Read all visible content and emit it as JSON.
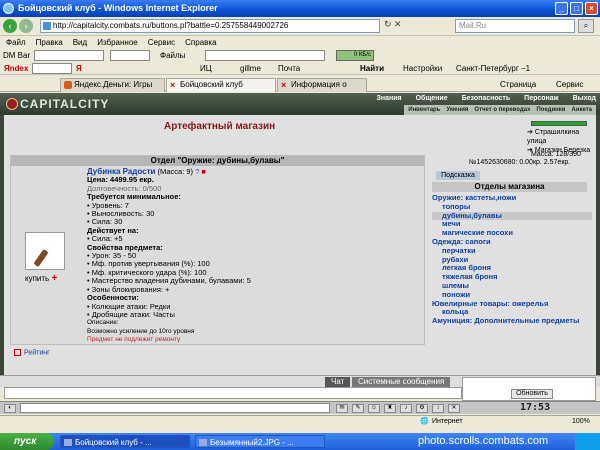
{
  "window": {
    "title": "Бойцовский клуб - Windows Internet Explorer"
  },
  "address": {
    "url": "http://capitalcity.combats.ru/buttons.pl?battle=0.257558449002726",
    "search_placeholder": "Mail.Ru"
  },
  "menu": [
    "Файл",
    "Правка",
    "Вид",
    "Избранное",
    "Сервис",
    "Справка"
  ],
  "toolbar1": {
    "dm_bar": "DM Bar",
    "files": "Файлы",
    "kbox": "0 КБ/с"
  },
  "toolbar2": {
    "yandex": "Яndex",
    "ya": "Я",
    "ic": "ИЦ",
    "gillme": "gillme",
    "mail": "Почта",
    "find": "Найти",
    "settings": "Настройки",
    "city": "Санкт-Петербург −1"
  },
  "tabs": [
    {
      "label": "Яндекс.Деньги: Игры"
    },
    {
      "label": "Бойцовский клуб"
    },
    {
      "label": "Информация о Вмянг"
    }
  ],
  "cmdbar": {
    "page": "Страница",
    "service": "Сервис"
  },
  "site": {
    "logo": "CAPITALCITY",
    "nav": [
      "Знания",
      "Общение",
      "Безопасность",
      "Персонаж",
      "Выход"
    ],
    "subnav": [
      "Инвентарь",
      "Умения",
      "Отчет о переводах",
      "Поединки",
      "Анкета"
    ]
  },
  "shop": {
    "title": "Артефактный магазин",
    "links": [
      "Страшилкина улица",
      "Магазин Березка"
    ],
    "mass": "Масса: 128/390",
    "money": "№1452630680: 0.00кр. 2.57екр.",
    "section_title": "Отдел \"Оружие: дубины,булавы\"",
    "buy_label": "купить",
    "item": {
      "name": "Дубинка Радости",
      "mass": "(Масса: 9)",
      "price": "Цена: 4499.95 екр.",
      "durability": "Долговечность: 0/500",
      "req_title": "Требуется минимальное:",
      "reqs": [
        "• Уровень: 7",
        "• Выносливость: 30",
        "• Сила: 30"
      ],
      "acts_title": "Действует на:",
      "acts": [
        "• Сила: +5"
      ],
      "props_title": "Свойства предмета:",
      "props": [
        "• Урон: 35 - 50",
        "• Мф. против увертывания (%): 100",
        "• Мф. критического удара (%): 100",
        "• Мастерство владения дубинами, булавами: 5",
        "• Зоны блокирования: +"
      ],
      "features_title": "Особенности:",
      "features": [
        "• Колющие атаки: Редки",
        "• Дробящие атаки: Часты"
      ],
      "desc_title": "Описание:",
      "desc": "Возможно усиление до 10го уровня",
      "note": "Предмет не подлежит ремонту"
    },
    "rating": "Рейтинг",
    "hint": "Подсказка",
    "departments_title": "Отделы магазина",
    "departments": [
      {
        "label": "Оружие: кастеты,ножи",
        "level": 0,
        "selected": false
      },
      {
        "label": "топоры",
        "level": 1,
        "selected": false
      },
      {
        "label": "дубины,булавы",
        "level": 1,
        "selected": true
      },
      {
        "label": "мечи",
        "level": 1,
        "selected": false
      },
      {
        "label": "магические посохи",
        "level": 1,
        "selected": false
      },
      {
        "label": "Одежда: сапоги",
        "level": 0,
        "selected": false
      },
      {
        "label": "перчатки",
        "level": 1,
        "selected": false
      },
      {
        "label": "рубахи",
        "level": 1,
        "selected": false
      },
      {
        "label": "легкая броня",
        "level": 1,
        "selected": false
      },
      {
        "label": "тяжелая броня",
        "level": 1,
        "selected": false
      },
      {
        "label": "шлемы",
        "level": 1,
        "selected": false
      },
      {
        "label": "поножи",
        "level": 1,
        "selected": false
      },
      {
        "label": "Ювелирные товары: ожерелья",
        "level": 0,
        "selected": false
      },
      {
        "label": "кольца",
        "level": 1,
        "selected": false
      },
      {
        "label": "Амуниция: Дополнительные предметы",
        "level": 0,
        "selected": false
      }
    ]
  },
  "chat": {
    "tab_chat": "Чат",
    "tab_system": "Системные сообщения",
    "refresh": "Обновить",
    "clock": "17:53"
  },
  "status": {
    "zone": "Интернет",
    "zoom": "100%"
  },
  "taskbar": {
    "start": "пуск",
    "tasks": [
      "Бойцовский клуб - ...",
      "Безымянный2.JPG - ..."
    ],
    "watermark": "photo.scrolls.combats.com"
  },
  "colors": {
    "accent_red": "#8b1414",
    "link_blue": "#0a3fa3",
    "site_header": "#3b4537"
  }
}
